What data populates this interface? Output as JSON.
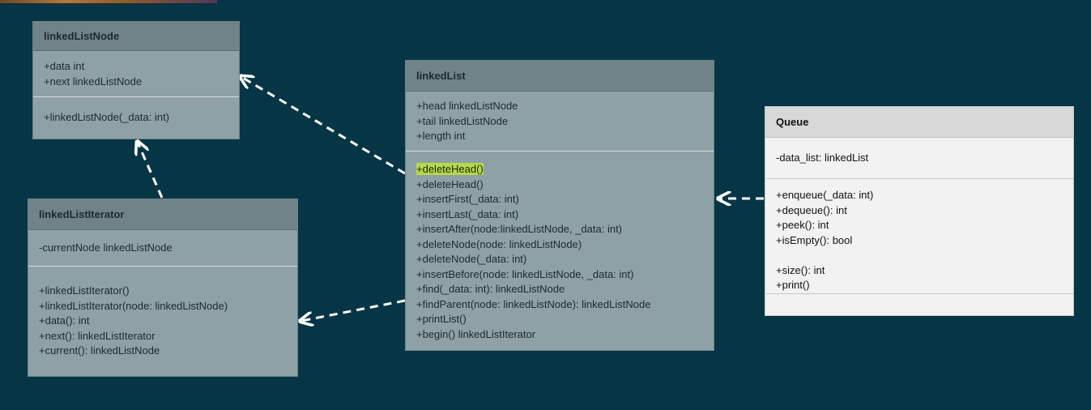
{
  "classes": {
    "node": {
      "name": "linkedListNode",
      "attributes": [
        "+data int",
        "+next linkedListNode"
      ],
      "methods": [
        "+linkedListNode(_data: int)"
      ]
    },
    "iterator": {
      "name": "linkedListIterator",
      "attributes": [
        "-currentNode linkedListNode"
      ],
      "methods": [
        "+linkedListIterator()",
        "+linkedListIterator(node: linkedListNode)",
        "+data(): int",
        "+next(): linkedListIterator",
        "+current(): linkedListNode"
      ]
    },
    "list": {
      "name": "linkedList",
      "attributes": [
        "+head linkedListNode",
        "+tail linkedListNode",
        "+length int"
      ],
      "methods": [
        "+deleteHead()",
        "+deleteHead()",
        "+insertFirst(_data: int)",
        "+insertLast(_data: int)",
        "+insertAfter(node:linkedListNode, _data: int)",
        "+deleteNode(node: linkedListNode)",
        "+deleteNode(_data: int)",
        "+insertBefore(node: linkedListNode, _data: int)",
        "+find(_data: int): linkedListNode",
        "+findParent(node: linkedListNode): linkedListNode",
        "+printList()",
        "+begin() linkedListIterator"
      ],
      "highlighted_method": "+deleteHead()"
    },
    "queue": {
      "name": "Queue",
      "attributes": [
        "-data_list: linkedList"
      ],
      "methods_group1": [
        "+enqueue(_data: int)",
        "+dequeue(): int",
        "+peek(): int",
        "+isEmpty(): bool"
      ],
      "methods_group2": [
        "+size(): int",
        "+print()"
      ]
    }
  },
  "relations": [
    {
      "from": "linkedList",
      "to": "linkedListNode",
      "style": "dashed"
    },
    {
      "from": "linkedListIterator",
      "to": "linkedListNode",
      "style": "dashed"
    },
    {
      "from": "linkedList",
      "to": "linkedListIterator",
      "style": "dashed"
    },
    {
      "from": "Queue",
      "to": "linkedList",
      "style": "dashed"
    }
  ],
  "colors": {
    "background": "#063645",
    "class_fill": "#8ea1a6",
    "class_header": "#6f8388",
    "queue_fill": "#f2f2f2",
    "queue_header": "#d8d8d8",
    "highlight": "#b5d94a",
    "arrow": "#ffffff"
  }
}
